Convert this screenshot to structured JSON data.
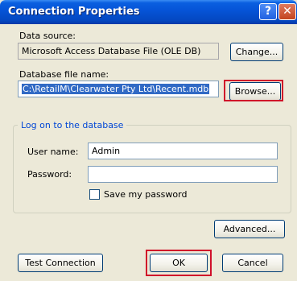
{
  "window": {
    "title": "Connection Properties"
  },
  "titlebar": {
    "help_label": "?",
    "close_label": "✕"
  },
  "data_source": {
    "label": "Data source:",
    "value": "Microsoft Access Database File (OLE DB)",
    "change_button": "Change..."
  },
  "db_file": {
    "label": "Database file name:",
    "value": "C:\\RetailM\\Clearwater Pty Ltd\\Recent.mdb",
    "browse_button": "Browse..."
  },
  "logon": {
    "legend": "Log on to the database",
    "user_label": "User name:",
    "user_value": "Admin",
    "password_label": "Password:",
    "password_value": "",
    "save_password_label": "Save my password",
    "save_password_checked": false
  },
  "buttons": {
    "advanced": "Advanced...",
    "test_connection": "Test Connection",
    "ok": "OK",
    "cancel": "Cancel"
  },
  "colors": {
    "highlight": "#d0102a",
    "titlebar": "#0553d6",
    "dialog_bg": "#ece9d8",
    "group_label": "#0046d5"
  }
}
